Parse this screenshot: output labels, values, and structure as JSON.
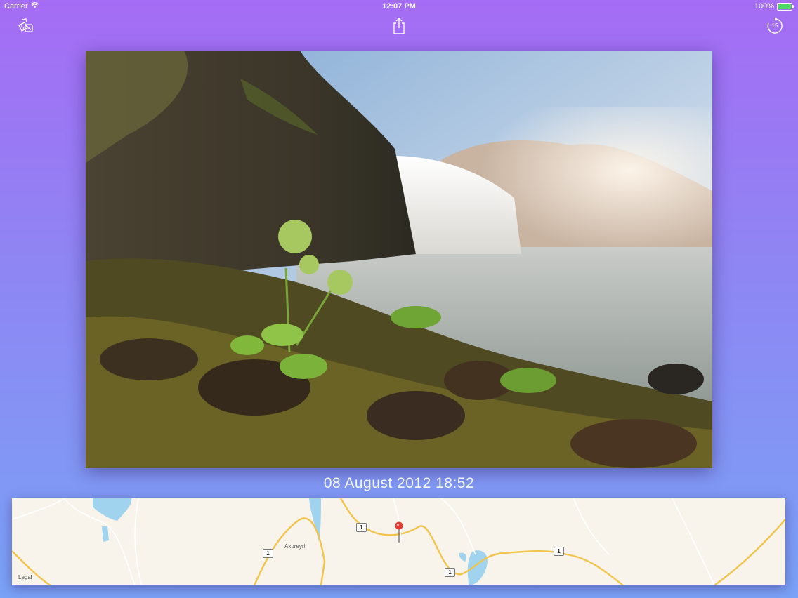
{
  "status_bar": {
    "carrier": "Carrier",
    "time": "12:07 PM",
    "battery": "100%"
  },
  "toolbar": {
    "left_icon": "dice-icon",
    "center_icon": "share-icon",
    "right_icon": "replay-15-icon",
    "replay_seconds": "15"
  },
  "photo": {
    "subject": "waterfall-landscape"
  },
  "caption": {
    "date": "08 August 2012 18:52"
  },
  "map": {
    "town": "Akureyri",
    "road_number": "1",
    "legal": "Legal",
    "pin_icon": "map-pin-icon",
    "colors": {
      "land": "#f8f4ec",
      "water": "#9fd3ee",
      "road": "#f2c44c",
      "pin": "#e53935"
    }
  }
}
